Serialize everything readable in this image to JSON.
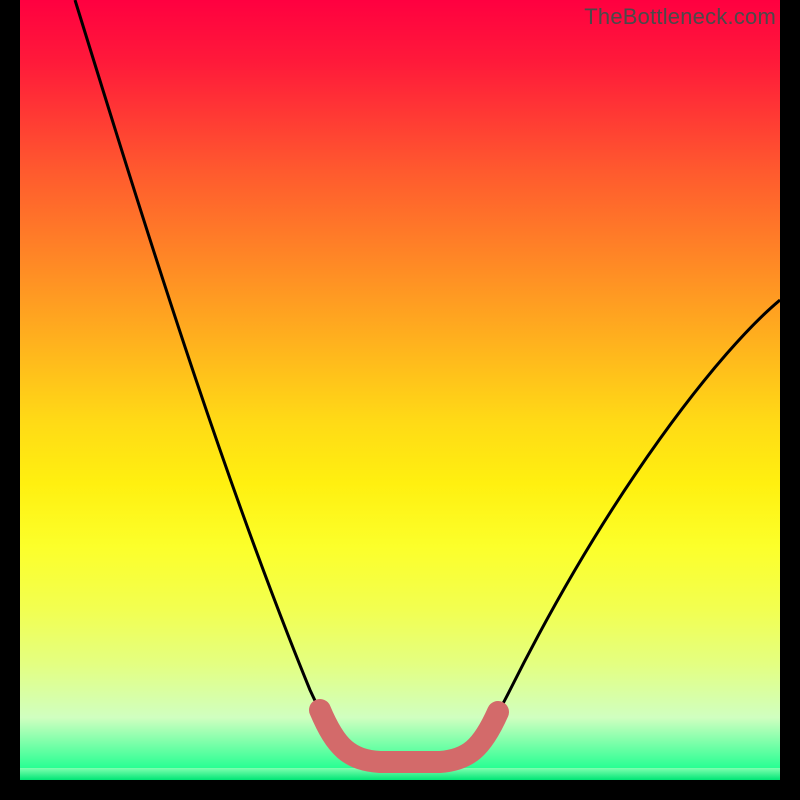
{
  "watermark": "TheBottleneck.com",
  "colors": {
    "curve": "#000000",
    "valley_highlight": "#d36a6a",
    "frame_bg": "#000000"
  },
  "chart_data": {
    "type": "line",
    "title": "",
    "xlabel": "",
    "ylabel": "",
    "xlim": [
      0,
      100
    ],
    "ylim": [
      0,
      100
    ],
    "series": [
      {
        "name": "bottleneck-curve",
        "x": [
          0,
          5,
          10,
          15,
          20,
          25,
          30,
          35,
          40,
          44,
          48,
          52,
          56,
          60,
          65,
          70,
          75,
          80,
          85,
          90,
          95,
          100
        ],
        "y": [
          100,
          90,
          80,
          70,
          60,
          50,
          40,
          30,
          20,
          10,
          4,
          4,
          10,
          18,
          27,
          34,
          40,
          46,
          51,
          56,
          60,
          64
        ]
      }
    ],
    "annotation": {
      "name": "valley-highlight",
      "x": [
        40,
        44,
        48,
        52,
        56,
        60
      ],
      "y": [
        20,
        10,
        4,
        4,
        10,
        18
      ]
    }
  }
}
